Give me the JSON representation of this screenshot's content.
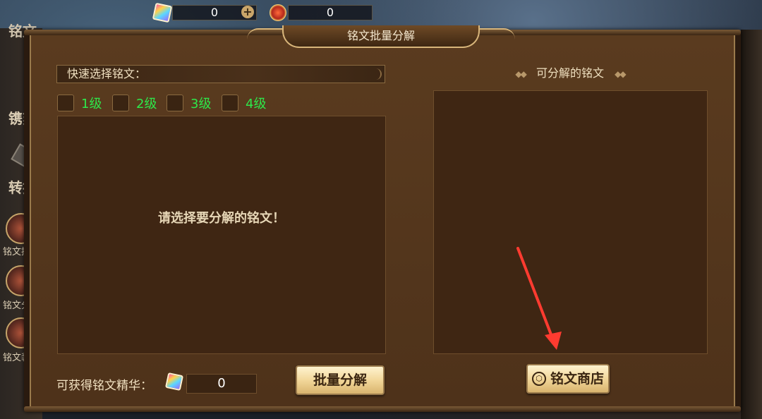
{
  "topbar": {
    "gems_value": "0",
    "medals_value": "0",
    "gem_icon": "rainbow-gem-icon",
    "medal_icon": "red-medal-icon",
    "add_icon": "plus-icon"
  },
  "sidebar": {
    "tab_top": "铭文",
    "items": [
      {
        "label": "镌刻",
        "icon": "engrave-icon"
      },
      {
        "label": "转换",
        "icon": "hexagon-icon"
      },
      {
        "label": "铭文推",
        "icon": "inscription-icon"
      },
      {
        "label": "铭文分",
        "icon": "inscription-icon"
      },
      {
        "label": "铭文装",
        "icon": "inscription-icon"
      }
    ]
  },
  "dialog": {
    "title": "铭文批量分解",
    "quick_select_label": "快速选择铭文：",
    "filters": [
      {
        "label": "1级",
        "checked": false
      },
      {
        "label": "2级",
        "checked": false
      },
      {
        "label": "3级",
        "checked": false
      },
      {
        "label": "4级",
        "checked": false
      }
    ],
    "empty_message": "请选择要分解的铭文！",
    "right_header": "可分解的铭文",
    "obtain_label": "可获得铭文精华：",
    "obtain_value": "0",
    "decompose_button": "批量分解",
    "shop_button": "铭文商店",
    "colors": {
      "filter_label": "#2ee84a",
      "panel_bg": "#4e321a",
      "box_bg": "#3f2613",
      "button_gold": "#f2d79a",
      "annotation_arrow": "#ff3b30"
    }
  }
}
